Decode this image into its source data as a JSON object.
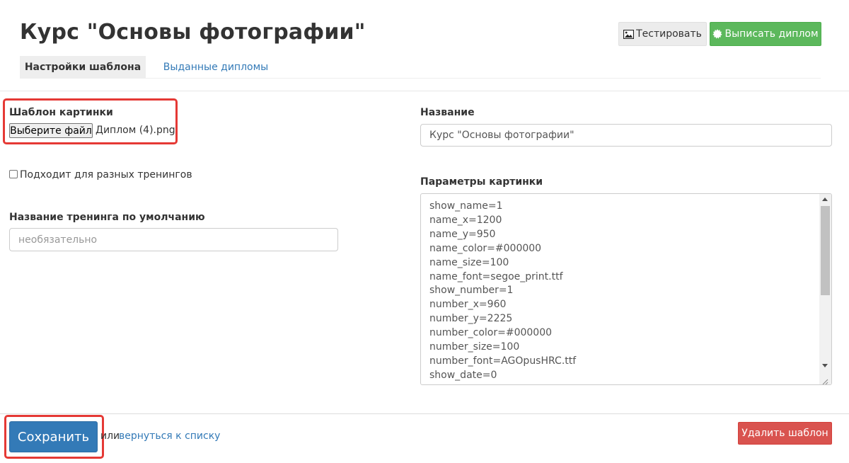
{
  "page": {
    "title": "Курс \"Основы фотографии\""
  },
  "header_buttons": {
    "test_label": "Тестировать",
    "test_icon": "image-icon",
    "issue_label": "Выписать диплом",
    "issue_icon": "certificate-icon"
  },
  "tabs": [
    {
      "label": "Настройки шаблона",
      "active": true
    },
    {
      "label": "Выданные дипломы",
      "active": false
    }
  ],
  "left_form": {
    "template_label": "Шаблон картинки",
    "file_button": "Выберите файл",
    "file_name": "Диплом (4).png",
    "multi_training_label": "Подходит для разных тренингов",
    "multi_training_checked": false,
    "default_training_label": "Название тренинга по умолчанию",
    "default_training_placeholder": "необязательно",
    "default_training_value": ""
  },
  "right_form": {
    "name_label": "Название",
    "name_value": "Курс \"Основы фотографии\"",
    "params_label": "Параметры картинки",
    "params_lines": [
      "show_name=1",
      "name_x=1200",
      "name_y=950",
      "name_color=#000000",
      "name_size=100",
      "name_font=segoe_print.ttf",
      "show_number=1",
      "number_x=960",
      "number_y=2225",
      "number_color=#000000",
      "number_size=100",
      "number_font=AGOpusHRC.ttf",
      "show_date=0"
    ]
  },
  "footer": {
    "save_label": "Сохранить",
    "or_text": "или",
    "back_link": "вернуться к списку",
    "delete_label": "Удалить шаблон"
  },
  "colors": {
    "primary": "#337ab7",
    "success": "#5cb85c",
    "danger": "#d9534f",
    "highlight": "#e53935"
  }
}
